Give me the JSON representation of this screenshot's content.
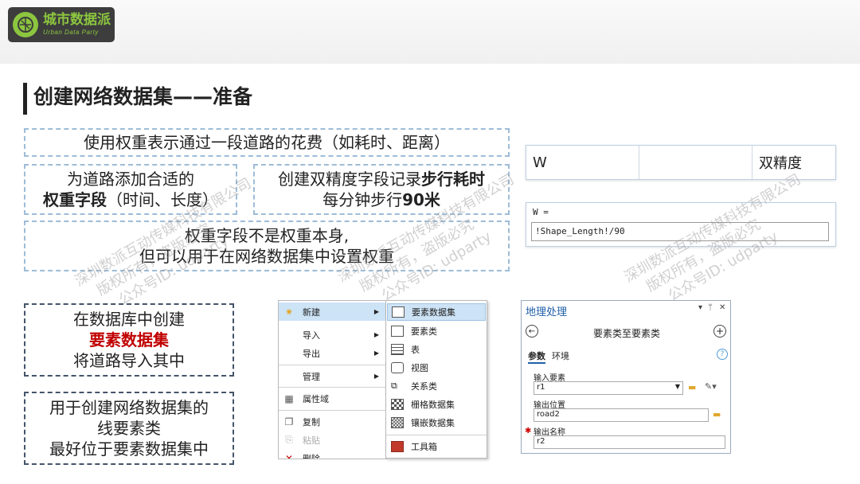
{
  "logo": {
    "cn": "城市数据派",
    "en": "Urban Data Party"
  },
  "title": "创建网络数据集——准备",
  "boxes": {
    "weight_cost": "使用权重表示通过一段道路的花费（如耗时、距离）",
    "add_field_line1": "为道路添加合适的",
    "add_field_bold": "权重字段",
    "add_field_rest": "（时间、长度）",
    "double_field_pre": "创建双精度字段记录",
    "double_field_bold": "步行耗时",
    "speed_pre": "每分钟步行",
    "speed_bold": "90米",
    "not_weight_line1": "权重字段不是权重本身,",
    "not_weight_line2": "但可以用于在网络数据集中设置权重",
    "db_line1": "在数据库中创建",
    "db_red": "要素数据集",
    "db_line3": "将道路导入其中",
    "fc_line1": "用于创建网络数据集的",
    "fc_line2": "线要素类",
    "fc_line3": "最好位于要素数据集中"
  },
  "field_table": {
    "name": "W",
    "type": "双精度"
  },
  "calc": {
    "label": "W =",
    "expression": "!Shape_Length!/90"
  },
  "context_menu": {
    "items": [
      "新建",
      "导入",
      "导出",
      "管理",
      "属性域",
      "复制",
      "粘贴",
      "删除"
    ]
  },
  "submenu": {
    "items": [
      "要素数据集",
      "要素类",
      "表",
      "视图",
      "关系类",
      "栅格数据集",
      "镶嵌数据集",
      "工具箱"
    ]
  },
  "geoprocessing": {
    "pane_title": "地理处理",
    "tool_name": "要素类至要素类",
    "tab_params": "参数",
    "tab_env": "环境",
    "input_label": "输入要素",
    "input_value": "r1",
    "output_loc_label": "输出位置",
    "output_loc_value": "road2",
    "output_name_label": "输出名称",
    "output_name_value": "r2"
  },
  "watermark": {
    "line1": "深圳数派互动传媒科技有限公司",
    "line2": "版权所有，盗版必究",
    "line3": "公众号ID: udparty"
  },
  "colors": {
    "accent_green": "#8cc63f",
    "dash_light": "#9dbcd8",
    "dash_dark": "#44546a",
    "red": "#c00000"
  }
}
